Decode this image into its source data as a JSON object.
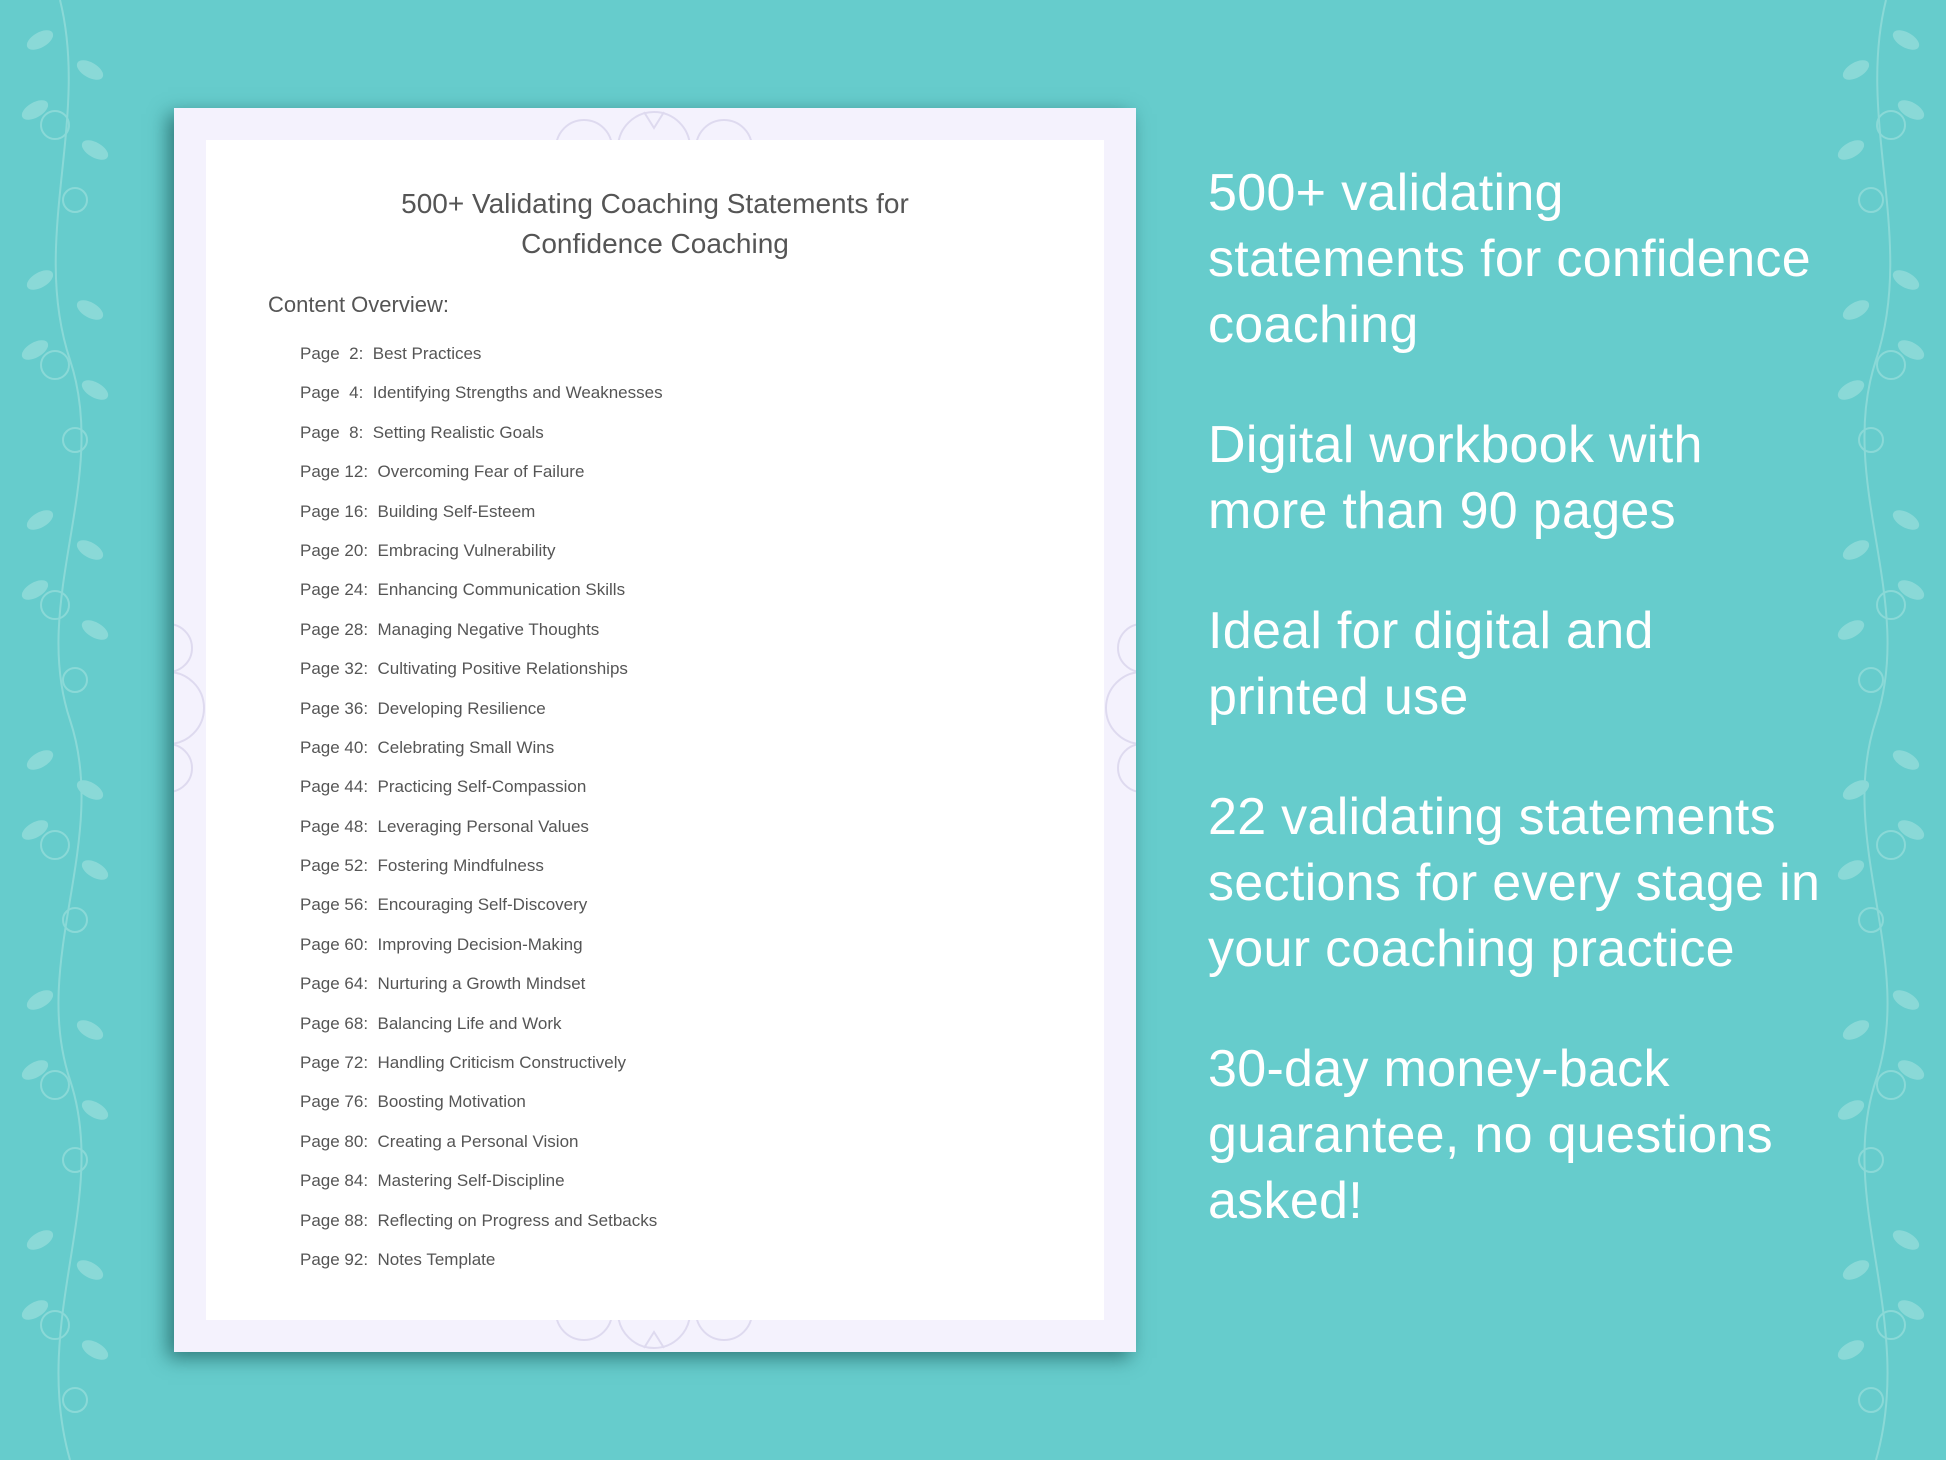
{
  "document": {
    "title_line1": "500+ Validating Coaching Statements for",
    "title_line2": "Confidence Coaching",
    "overview_label": "Content Overview:",
    "toc": [
      {
        "page": "Page  2:",
        "topic": "Best Practices"
      },
      {
        "page": "Page  4:",
        "topic": "Identifying Strengths and Weaknesses"
      },
      {
        "page": "Page  8:",
        "topic": "Setting Realistic Goals"
      },
      {
        "page": "Page 12:",
        "topic": "Overcoming Fear of Failure"
      },
      {
        "page": "Page 16:",
        "topic": "Building Self-Esteem"
      },
      {
        "page": "Page 20:",
        "topic": "Embracing Vulnerability"
      },
      {
        "page": "Page 24:",
        "topic": "Enhancing Communication Skills"
      },
      {
        "page": "Page 28:",
        "topic": "Managing Negative Thoughts"
      },
      {
        "page": "Page 32:",
        "topic": "Cultivating Positive Relationships"
      },
      {
        "page": "Page 36:",
        "topic": "Developing Resilience"
      },
      {
        "page": "Page 40:",
        "topic": "Celebrating Small Wins"
      },
      {
        "page": "Page 44:",
        "topic": "Practicing Self-Compassion"
      },
      {
        "page": "Page 48:",
        "topic": "Leveraging Personal Values"
      },
      {
        "page": "Page 52:",
        "topic": "Fostering Mindfulness"
      },
      {
        "page": "Page 56:",
        "topic": "Encouraging Self-Discovery"
      },
      {
        "page": "Page 60:",
        "topic": "Improving Decision-Making"
      },
      {
        "page": "Page 64:",
        "topic": "Nurturing a Growth Mindset"
      },
      {
        "page": "Page 68:",
        "topic": "Balancing Life and Work"
      },
      {
        "page": "Page 72:",
        "topic": "Handling Criticism Constructively"
      },
      {
        "page": "Page 76:",
        "topic": "Boosting Motivation"
      },
      {
        "page": "Page 80:",
        "topic": "Creating a Personal Vision"
      },
      {
        "page": "Page 84:",
        "topic": "Mastering Self-Discipline"
      },
      {
        "page": "Page 88:",
        "topic": "Reflecting on Progress and Setbacks"
      },
      {
        "page": "Page 92:",
        "topic": "Notes Template"
      }
    ]
  },
  "features": [
    "500+ validating statements for confidence coaching",
    "Digital workbook with more than 90 pages",
    "Ideal for digital and printed use",
    "22 validating statements sections for every stage in your coaching practice",
    "30-day money-back guarantee, no questions asked!"
  ],
  "colors": {
    "background": "#66cccc",
    "document_border": "#f4f2fd",
    "text_dark": "#555555",
    "text_light": "#ffffff"
  },
  "icons": [
    "floral-vine-icon",
    "mandala-ornament-icon"
  ]
}
